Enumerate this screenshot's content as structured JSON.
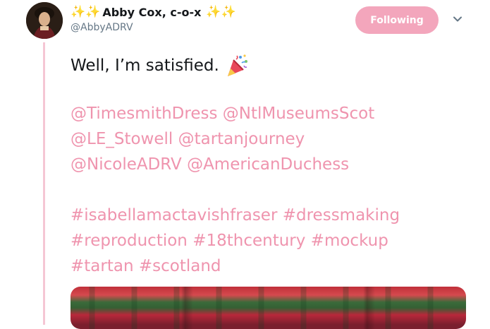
{
  "author": {
    "display_name": "Abby Cox, c-o-x",
    "handle": "@AbbyADRV",
    "sparkle_left": "✨✨",
    "sparkle_right": "✨✨"
  },
  "follow_button": {
    "label": "Following",
    "color": "#f3a6bc"
  },
  "tweet": {
    "lead_text": "Well, I’m satisfied.",
    "lead_emoji": "party-popper-icon",
    "mentions": [
      [
        "@TimesmithDress",
        "@NtlMuseumsScot"
      ],
      [
        "@LE_Stowell",
        "@tartanjourney"
      ],
      [
        "@NicoleADRV",
        "@AmericanDuchess"
      ]
    ],
    "hashtags": [
      [
        "#isabellamactavishfraser",
        "#dressmaking"
      ],
      [
        "#reproduction",
        "#18thcentury",
        "#mockup"
      ],
      [
        "#tartan",
        "#scotland"
      ]
    ]
  },
  "colors": {
    "link": "#ef94ae",
    "thread_line": "#f5c6d4",
    "text": "#14171a",
    "secondary_text": "#657786"
  }
}
